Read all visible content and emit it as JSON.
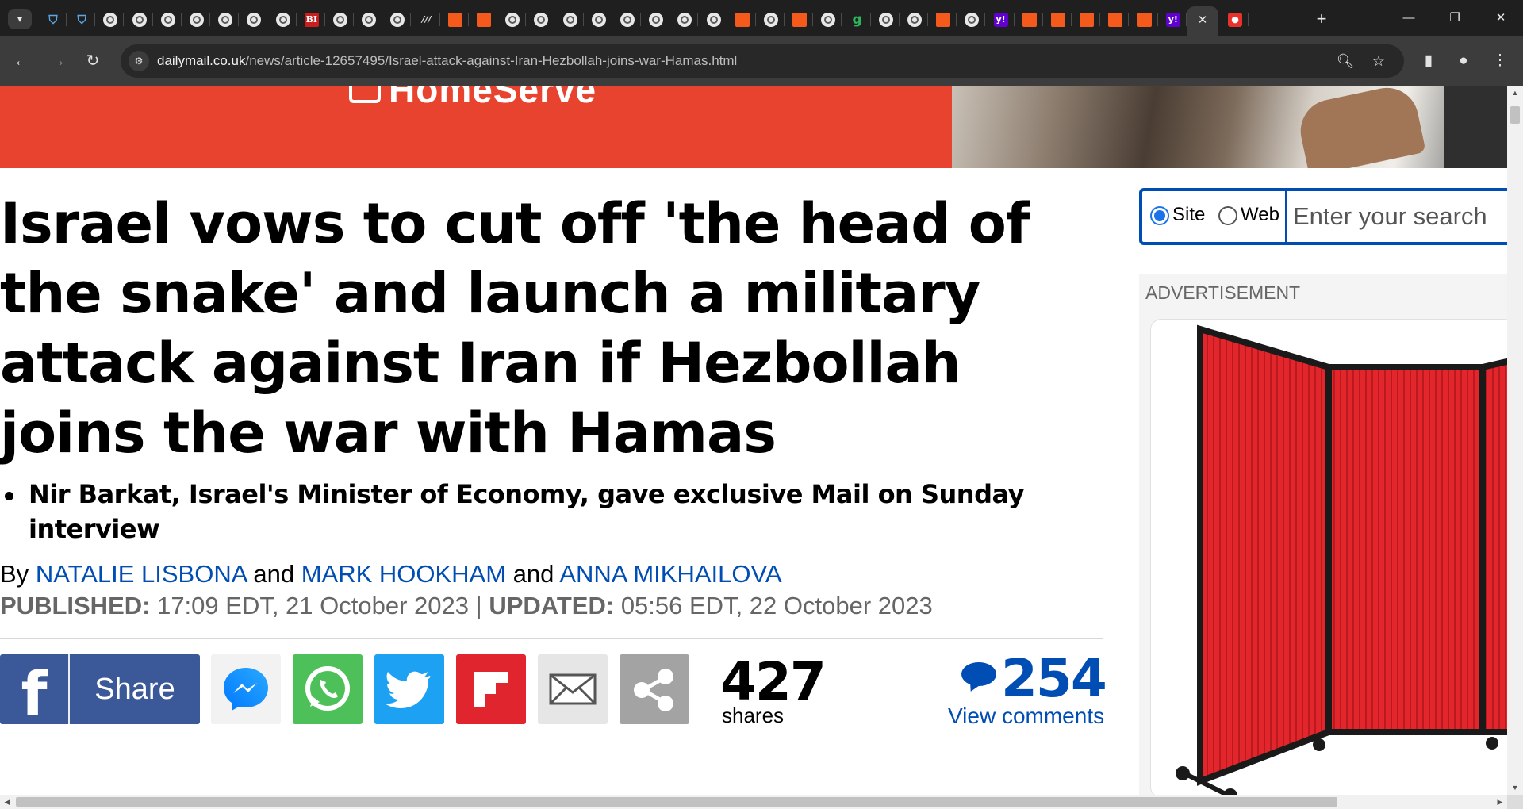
{
  "browser": {
    "tabs": [
      {
        "icon": "shield-icon",
        "glyph": "⛉"
      },
      {
        "icon": "shield-icon",
        "glyph": "⛉"
      },
      {
        "icon": "globe-icon"
      },
      {
        "icon": "globe-icon"
      },
      {
        "icon": "globe-icon"
      },
      {
        "icon": "globe-icon"
      },
      {
        "icon": "globe-icon"
      },
      {
        "icon": "globe-icon"
      },
      {
        "icon": "globe-icon"
      },
      {
        "icon": "business-insider-icon",
        "glyph": "BI"
      },
      {
        "icon": "globe-icon"
      },
      {
        "icon": "globe-icon"
      },
      {
        "icon": "globe-icon"
      },
      {
        "icon": "ww-icon",
        "glyph": "///"
      },
      {
        "icon": "bookmark-icon"
      },
      {
        "icon": "bookmark-icon"
      },
      {
        "icon": "globe-icon"
      },
      {
        "icon": "globe-icon"
      },
      {
        "icon": "globe-icon"
      },
      {
        "icon": "globe-icon"
      },
      {
        "icon": "globe-icon"
      },
      {
        "icon": "globe-icon"
      },
      {
        "icon": "globe-icon"
      },
      {
        "icon": "globe-icon"
      },
      {
        "icon": "bookmark-icon"
      },
      {
        "icon": "globe-icon"
      },
      {
        "icon": "bookmark-icon"
      },
      {
        "icon": "globe-icon"
      },
      {
        "icon": "g-icon",
        "glyph": "g"
      },
      {
        "icon": "globe-icon"
      },
      {
        "icon": "globe-icon"
      },
      {
        "icon": "bookmark-icon"
      },
      {
        "icon": "globe-icon"
      },
      {
        "icon": "yahoo-icon",
        "glyph": "y!"
      },
      {
        "icon": "bookmark-icon"
      },
      {
        "icon": "bookmark-icon"
      },
      {
        "icon": "bookmark-icon"
      },
      {
        "icon": "bookmark-icon"
      },
      {
        "icon": "bookmark-icon"
      },
      {
        "icon": "yahoo-icon",
        "glyph": "y!"
      },
      {
        "icon": "close-icon",
        "glyph": "✕",
        "active": true
      },
      {
        "icon": "microphone-icon",
        "glyph": "●"
      }
    ],
    "new_tab_glyph": "+",
    "url_host": "dailymail.co.uk",
    "url_path": "/news/article-12657495/Israel-attack-against-Iran-Hezbollah-joins-war-Hamas.html"
  },
  "article": {
    "headline": "Israel vows to cut off 'the head of the snake' and launch a military attack against Iran if Hezbollah joins the war with Hamas",
    "bullets": [
      "Nir Barkat, Israel's Minister of Economy, gave exclusive Mail on Sunday interview"
    ],
    "byline": {
      "prefix": "By",
      "and_1": "and",
      "and_2": "and",
      "authors": [
        "NATALIE LISBONA",
        "MARK HOOKHAM",
        "ANNA MIKHAILOVA"
      ]
    },
    "published_label": "PUBLISHED:",
    "published": "17:09 EDT, 21 October 2023",
    "date_sep": "|",
    "updated_label": "UPDATED:",
    "updated": "05:56 EDT, 22 October 2023"
  },
  "share": {
    "facebook_label": "Share",
    "shares_count": "427",
    "shares_label": "shares",
    "comments_count": "254",
    "view_comments": "View comments",
    "colors": {
      "facebook": "#3b5998",
      "messenger": "#f2f2f2",
      "whatsapp": "#4ec05a",
      "twitter": "#1da1f2",
      "flipboard": "#e1252f",
      "email": "#e6e6e6",
      "more": "#a3a3a3"
    }
  },
  "sidebar": {
    "search": {
      "option_site": "Site",
      "option_web": "Web",
      "selected": "Site",
      "placeholder": "Enter your search"
    },
    "ad_label": "ADVERTISEMENT"
  },
  "ad_banner": {
    "brand": "HomeServe",
    "color": "#e8432f"
  }
}
